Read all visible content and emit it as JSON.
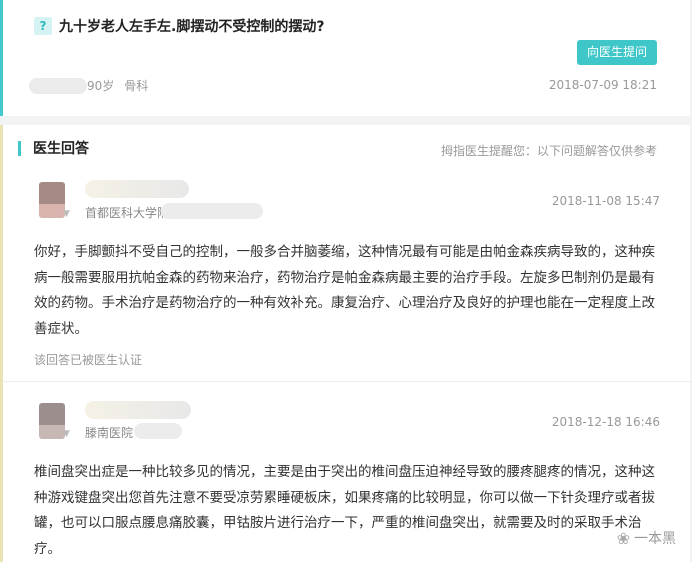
{
  "question": {
    "icon": "?",
    "title": "九十岁老人左手左.脚摆动不受控制的摆动?",
    "ask_button": "向医生提问",
    "age": "90岁",
    "department": "骨科",
    "date": "2018-07-09 18:21"
  },
  "answers_section": {
    "heading": "医生回答",
    "notice": "拇指医生提醒您：以下问题解答仅供参考"
  },
  "answers": [
    {
      "hospital": "首都医科大学附",
      "date": "2018-11-08 15:47",
      "text": "你好，手脚颤抖不受自己的控制，一般多合并脑萎缩，这种情况最有可能是由帕金森疾病导致的，这种疾病一般需要服用抗帕金森的药物来治疗，药物治疗是帕金森病最主要的治疗手段。左旋多巴制剂仍是最有效的药物。手术治疗是药物治疗的一种有效补充。康复治疗、心理治疗及良好的护理也能在一定程度上改善症状。",
      "certified": "该回答已被医生认证"
    },
    {
      "hospital": "滕南医院",
      "date": "2018-12-18 16:46",
      "text": "椎间盘突出症是一种比较多见的情况，主要是由于突出的椎间盘压迫神经导致的腰疼腿疼的情况，这种这种游戏键盘突出您首先注意不要受凉劳累睡硬板床，如果疼痛的比较明显，你可以做一下针灸理疗或者拔罐，也可以口服点腰息痛胶囊，甲钴胺片进行治疗一下，严重的椎间盘突出，就需要及时的采取手术治疗。"
    }
  ],
  "watermark": "一本黑"
}
